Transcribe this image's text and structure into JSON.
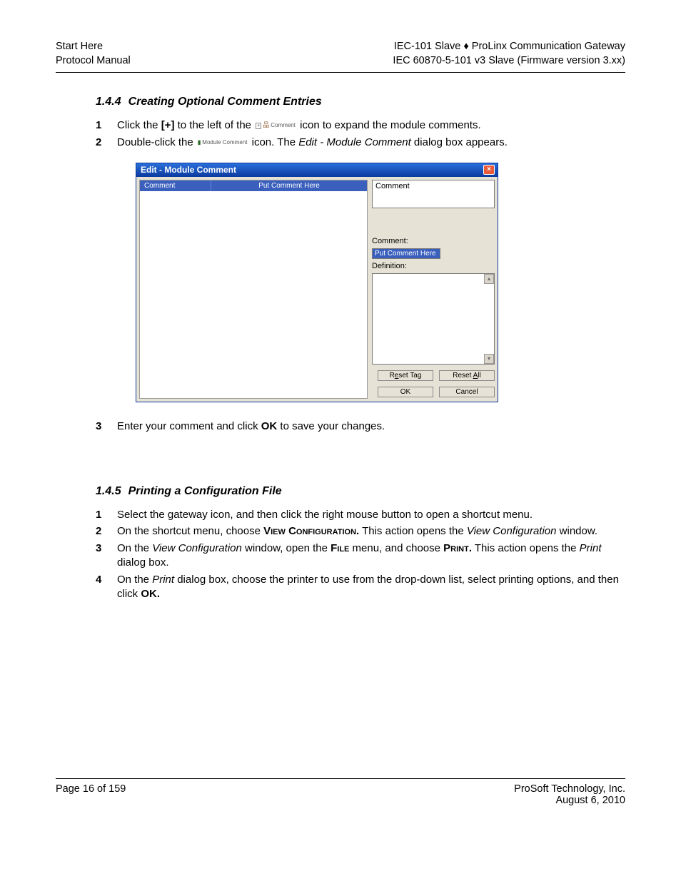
{
  "header": {
    "left_line1": "Start Here",
    "left_line2": "Protocol Manual",
    "right_line1": "IEC-101 Slave ♦ ProLinx Communication Gateway",
    "right_line2": "IEC 60870-5-101 v3 Slave   (Firmware version 3.xx)"
  },
  "section144": {
    "number": "1.4.4",
    "title": "Creating Optional Comment Entries",
    "step1_pre": "Click the ",
    "step1_plus": "[+]",
    "step1_mid": " to the left of the ",
    "step1_icon_text": "Comment",
    "step1_post": " icon to expand the module comments.",
    "step2_pre": "Double-click the ",
    "step2_icon_text": "Module Comment",
    "step2_mid": " icon. The ",
    "step2_em": "Edit - Module Comment",
    "step2_post": " dialog box appears.",
    "step3_pre": "Enter your comment and click ",
    "step3_ok": "OK",
    "step3_post": " to save your changes."
  },
  "dialog": {
    "title": "Edit - Module Comment",
    "col1": "Comment",
    "col2": "Put Comment Here",
    "right_top_value": "Comment",
    "label_comment": "Comment:",
    "comment_value": "Put Comment Here",
    "label_definition": "Definition:",
    "btn_reset_tag_pre": "R",
    "btn_reset_tag_u": "e",
    "btn_reset_tag_post": "set Tag",
    "btn_reset_all_pre": "Reset ",
    "btn_reset_all_u": "A",
    "btn_reset_all_post": "ll",
    "btn_ok": "OK",
    "btn_cancel": "Cancel"
  },
  "section145": {
    "number": "1.4.5",
    "title": "Printing a Configuration File",
    "s1": "Select the gateway icon, and then click the right mouse button to open a shortcut menu.",
    "s2_pre": "On the shortcut menu, choose ",
    "s2_sc": "View Configuration.",
    "s2_mid": " This action opens the ",
    "s2_em": "View Configuration",
    "s2_post": " window.",
    "s3_pre": "On the ",
    "s3_em1": "View Configuration",
    "s3_mid1": " window, open the ",
    "s3_sc1": "File",
    "s3_mid2": " menu, and choose ",
    "s3_sc2": "Print.",
    "s3_post_pre": " This action opens the ",
    "s3_em2": "Print",
    "s3_post": " dialog box.",
    "s4_pre": "On the ",
    "s4_em": "Print",
    "s4_mid": " dialog box, choose the printer to use from the drop-down list, select printing options, and then click ",
    "s4_ok": "OK."
  },
  "footer": {
    "left": "Page 16 of 159",
    "right_line1": "ProSoft Technology, Inc.",
    "right_line2": "August 6, 2010"
  }
}
